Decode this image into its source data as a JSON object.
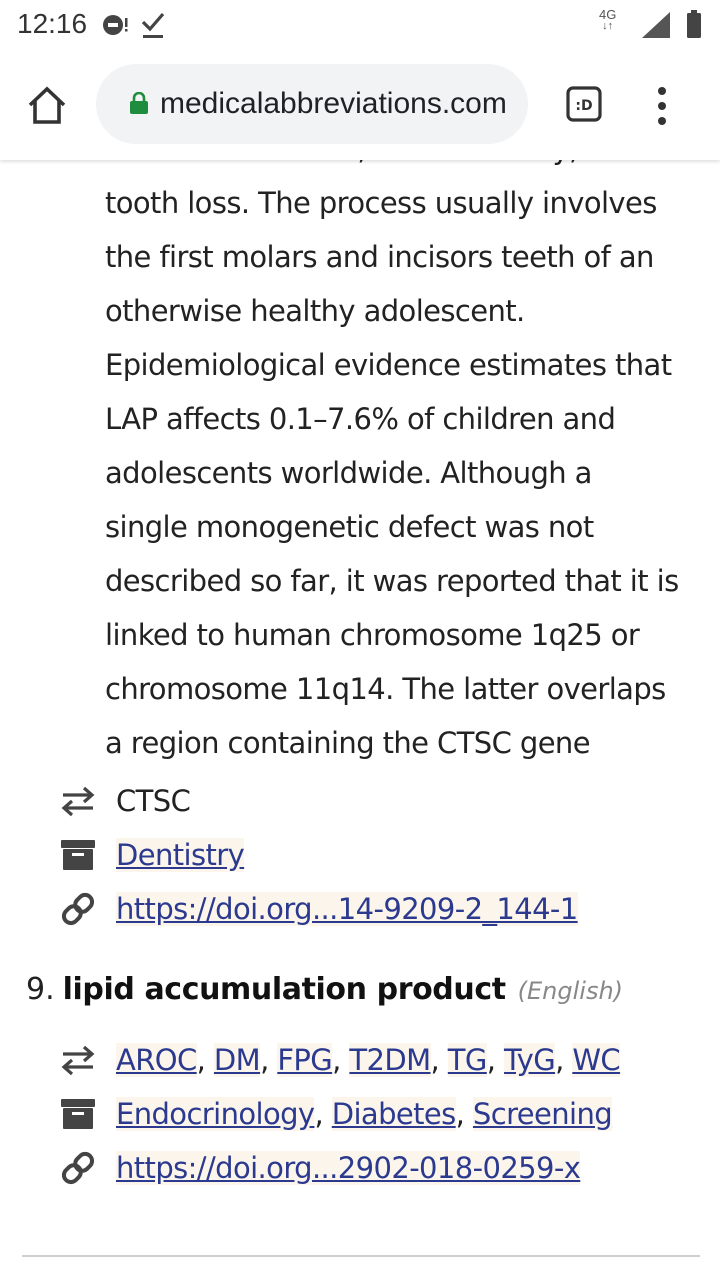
{
  "status_bar": {
    "time": "12:16",
    "network": "4G"
  },
  "browser": {
    "url": "medicalabbreviations.com"
  },
  "article": {
    "paragraph_lines": [
      "alveolar bone loss, tooth mobility, and",
      "tooth loss. The process usually involves",
      "the first molars and incisors teeth of an",
      "otherwise healthy adolescent.",
      "Epidemiological evidence estimates that",
      "LAP affects 0.1–7.6% of children and",
      "adolescents worldwide. Although a",
      "single monogenetic defect was not",
      "described so far, it was reported that it is",
      "linked to human chromosome 1q25 or",
      "chromosome 11q14. The latter overlaps",
      "a region containing the CTSC gene"
    ],
    "entry8": {
      "related": "CTSC",
      "category": "Dentistry",
      "doi": "https://doi.org...14-9209-2_144-1"
    },
    "entry9": {
      "number": "9.",
      "term": "lipid accumulation product",
      "language": "(English)",
      "related": [
        "AROC",
        "DM",
        "FPG",
        "T2DM",
        "TG",
        "TyG",
        "WC"
      ],
      "categories": [
        "Endocrinology",
        "Diabetes",
        "Screening"
      ],
      "doi": "https://doi.org...2902-018-0259-x"
    }
  },
  "colors": {
    "link": "#2b3a8f",
    "link_bg": "#fbf5ec",
    "lock_green": "#1e8e3e"
  }
}
